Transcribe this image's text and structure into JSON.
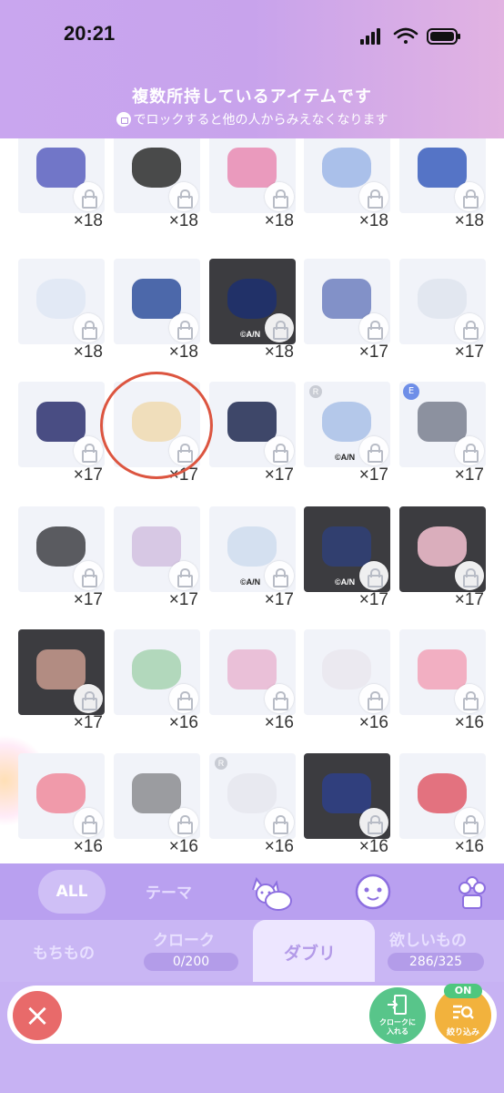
{
  "status": {
    "time": "20:21"
  },
  "header": {
    "line1": "複数所持しているアイテムです",
    "line2": "でロックすると他の人からみえなくなります"
  },
  "copyright_mark": "©A/N",
  "rank_badge": "R",
  "event_badge": "E",
  "grid": {
    "rows": [
      [
        "×18",
        "×18",
        "×18",
        "×18",
        "×18"
      ],
      [
        "×18",
        "×18",
        "×18",
        "×17",
        "×17"
      ],
      [
        "×17",
        "×17",
        "×17",
        "×17",
        "×17"
      ],
      [
        "×17",
        "×17",
        "×17",
        "×17",
        "×17"
      ],
      [
        "×17",
        "×16",
        "×16",
        "×16",
        "×16"
      ],
      [
        "×16",
        "×16",
        "×16",
        "×16",
        "×16"
      ]
    ]
  },
  "tabs": {
    "all": "ALL",
    "theme": "テーマ",
    "icons": [
      "pets-icon",
      "face-icon",
      "plant-icon"
    ]
  },
  "subtabs": {
    "mochimono": "もちもの",
    "cloak": "クローク",
    "cloak_count": "0/200",
    "duplicates": "ダブリ",
    "wishlist": "欲しいもの",
    "wishlist_count": "286/325"
  },
  "actions": {
    "close": "×",
    "cloak_label": "クロークに\n入れる",
    "filter_on": "ON",
    "filter_label": "絞り込み"
  },
  "colors": {
    "header_purple": "#c9a6ef",
    "tab_purple": "#b9a0f0",
    "close_red": "#e86a6a",
    "cloak_green": "#58c58a",
    "filter_orange": "#f2b23d",
    "highlight_circle": "#dc5540"
  }
}
